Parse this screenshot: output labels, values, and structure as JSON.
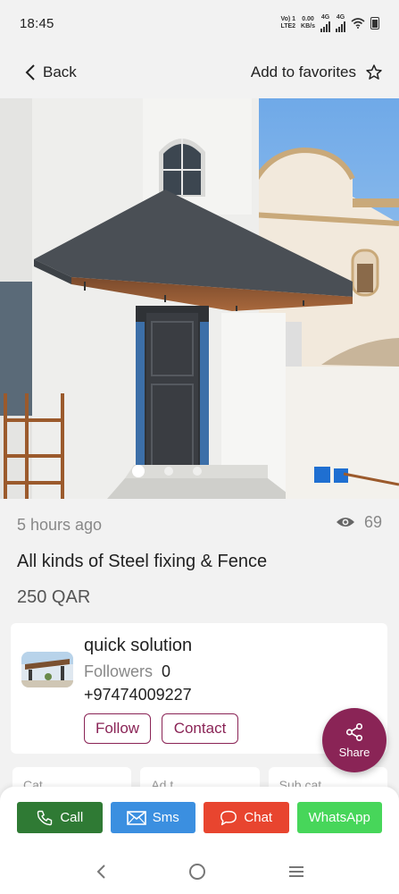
{
  "status_bar": {
    "time": "18:45",
    "network_label_1": "Vo) 1",
    "network_label_2": "LTE2",
    "speed_value": "0.00",
    "speed_unit": "KB/s",
    "sim1_label": "4G",
    "sim2_label": "4G"
  },
  "top_bar": {
    "back_label": "Back",
    "favorites_label": "Add to favorites"
  },
  "gallery": {
    "image_count": 3,
    "active_index": 0
  },
  "listing": {
    "posted_time": "5 hours ago",
    "views": "69",
    "title": "All kinds of Steel fixing & Fence",
    "price": "250 QAR"
  },
  "seller": {
    "name": "quick solution",
    "followers_label": "Followers",
    "followers_count": "0",
    "phone": "+97474009227",
    "follow_label": "Follow",
    "contact_label": "Contact"
  },
  "share_label": "Share",
  "category_cards": [
    "Cat",
    "Ad t",
    "Sub cat"
  ],
  "actions": {
    "call_label": "Call",
    "sms_label": "Sms",
    "chat_label": "Chat",
    "whatsapp_label": "WhatsApp"
  },
  "colors": {
    "accent": "#8a2456",
    "call": "#2f7a34",
    "sms": "#3b8fe0",
    "chat": "#e8452f",
    "whatsapp": "#47d65a"
  }
}
